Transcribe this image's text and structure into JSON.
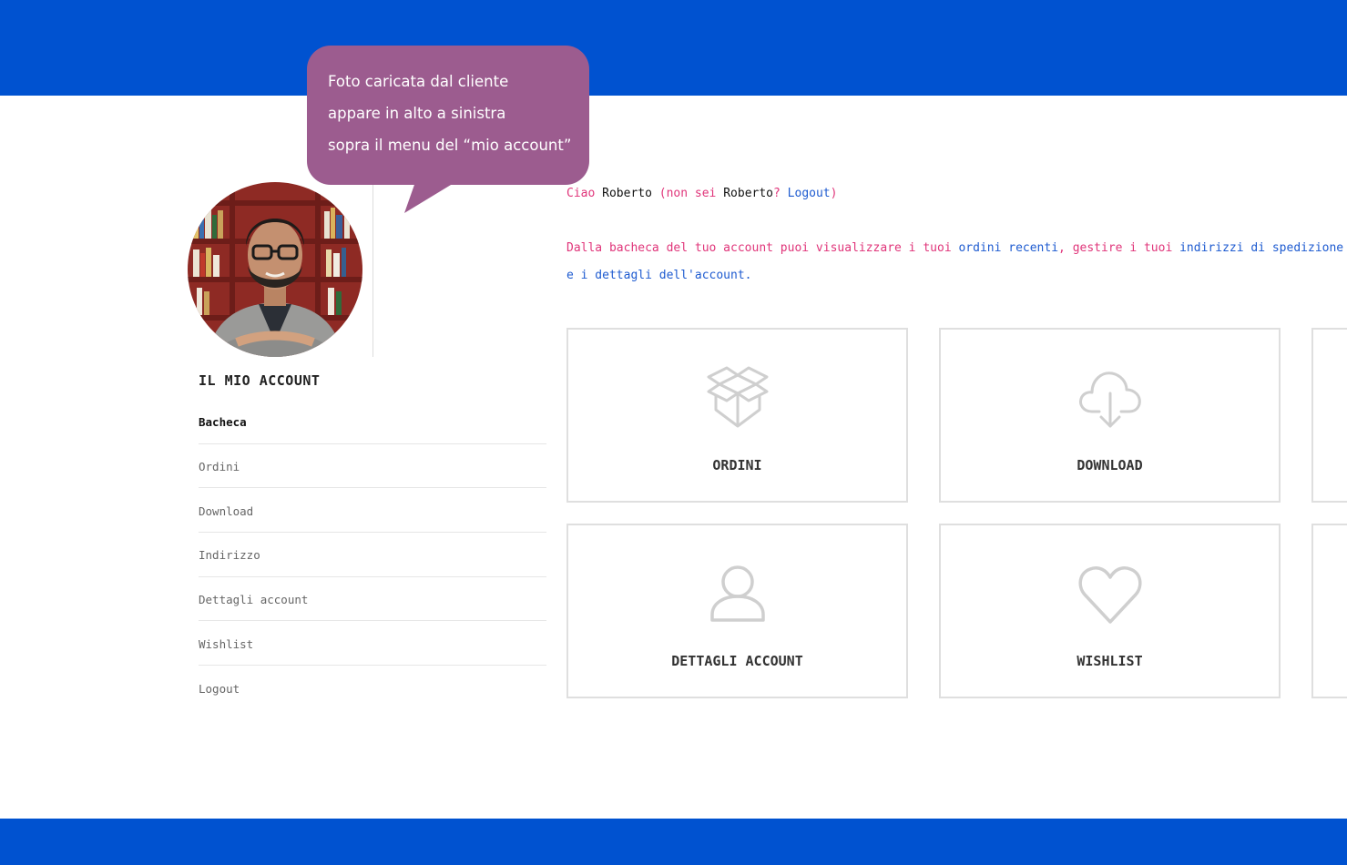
{
  "callout": {
    "lines": [
      "Foto caricata dal cliente",
      "appare in alto a sinistra",
      "sopra il menu del “mio account”"
    ]
  },
  "sidebar": {
    "title": "IL MIO ACCOUNT",
    "items": [
      {
        "label": "Bacheca"
      },
      {
        "label": "Ordini"
      },
      {
        "label": "Download"
      },
      {
        "label": "Indirizzo"
      },
      {
        "label": "Dettagli account"
      },
      {
        "label": "Wishlist"
      },
      {
        "label": "Logout"
      }
    ]
  },
  "greeting": {
    "hello": "Ciao",
    "name": "Roberto",
    "not_open": "(non sei",
    "name2": "Roberto",
    "q": "?",
    "logout": "Logout",
    "close": ")"
  },
  "intro": {
    "t1": "Dalla bacheca del tuo account puoi visualizzare i tuoi",
    "link1": "ordini recenti",
    "t2": ", gestire i tuoi",
    "link2": "indirizzi di spedizione",
    "t3": "e i dettagli dell'account",
    "t4": "."
  },
  "tiles": [
    {
      "label": "ORDINI",
      "icon": "box-icon"
    },
    {
      "label": "DOWNLOAD",
      "icon": "cloud-download-icon"
    },
    {
      "label": "DETTAGLI ACCOUNT",
      "icon": "user-icon"
    },
    {
      "label": "WISHLIST",
      "icon": "heart-icon"
    }
  ],
  "colors": {
    "brand_blue": "#0052d0",
    "bubble": "#9c5c8f",
    "accent_pink": "#e0357a",
    "link_blue": "#1e5bd0"
  }
}
